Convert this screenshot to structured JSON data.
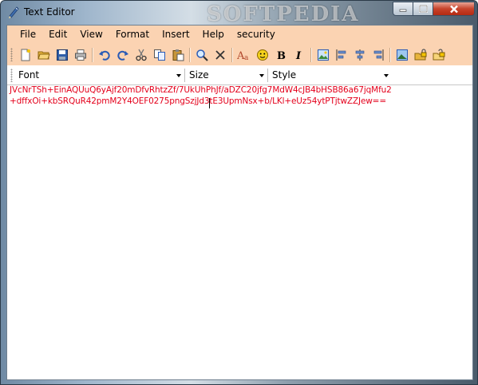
{
  "window": {
    "title": "Text Editor",
    "watermark": "SOFTPEDIA",
    "caption_buttons": [
      "minimize-icon",
      "maximize-icon",
      "close-icon"
    ]
  },
  "menu": {
    "items": [
      "File",
      "Edit",
      "View",
      "Format",
      "Insert",
      "Help",
      "security"
    ]
  },
  "toolbar": {
    "buttons": [
      "new-icon",
      "open-icon",
      "save-icon",
      "print-icon",
      "undo-icon",
      "redo-icon",
      "cut-icon",
      "copy-icon",
      "paste-icon",
      "find-icon",
      "delete-icon",
      "font-color-icon",
      "emoticon-icon",
      "bold-icon",
      "italic-icon",
      "insert-image-icon",
      "align-left-icon",
      "align-center-icon",
      "align-right-icon",
      "picture-icon",
      "encrypt-icon",
      "decrypt-icon"
    ]
  },
  "format": {
    "font_label": "Font",
    "size_label": "Size",
    "style_label": "Style"
  },
  "editor": {
    "lines": [
      "JVcNrTSh+EinAQUuQ6yAjf20mDfvRhtzZf/7UkUhPhJf/aDZC20jfg7MdW4cJB4bHSB86a67jqMfu2",
      "+dffxOi+kbSRQuR42pmM2Y4OEF0275pngSzjJd3tE3UpmNsx+b/LKl+eUz54ytPTjtwZZJew=="
    ]
  },
  "colors": {
    "menu_background": "#fbd3b2",
    "text_color": "#e4001b"
  }
}
